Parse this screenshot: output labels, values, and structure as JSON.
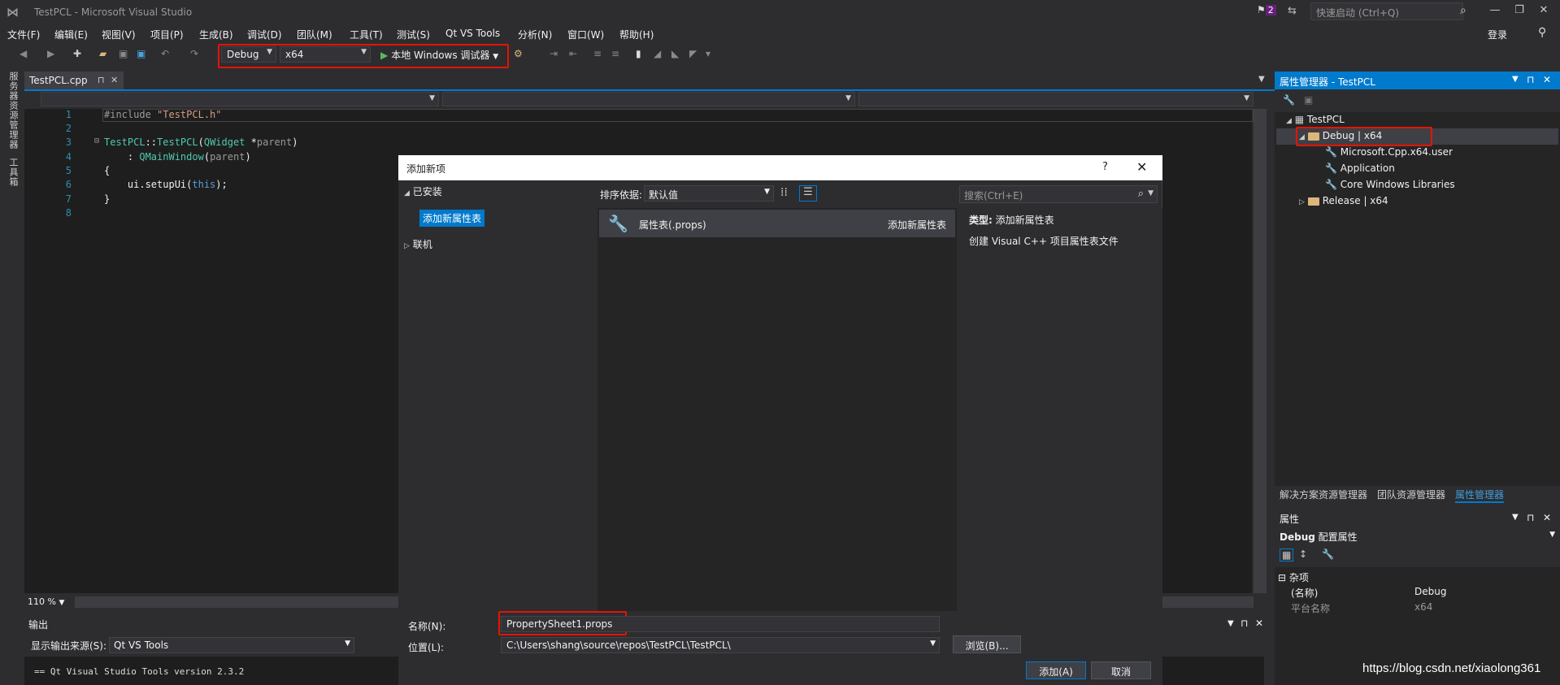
{
  "window": {
    "title": "TestPCL - Microsoft Visual Studio",
    "notification_count": "2",
    "quick_launch_placeholder": "快速启动 (Ctrl+Q)",
    "login": "登录"
  },
  "menu": [
    "文件(F)",
    "编辑(E)",
    "视图(V)",
    "项目(P)",
    "生成(B)",
    "调试(D)",
    "团队(M)",
    "工具(T)",
    "测试(S)",
    "Qt VS Tools",
    "分析(N)",
    "窗口(W)",
    "帮助(H)"
  ],
  "toolbar": {
    "config": "Debug",
    "platform": "x64",
    "run_label": "本地 Windows 调试器"
  },
  "left_tabs": [
    "服务器资源管理器",
    "工具箱"
  ],
  "editor": {
    "tab": "TestPCL.cpp",
    "zoom": "110 %",
    "lines": [
      "1",
      "2",
      "3",
      "4",
      "5",
      "6",
      "7",
      "8"
    ]
  },
  "output": {
    "title": "输出",
    "source_label": "显示输出来源(S):",
    "source": "Qt VS Tools",
    "line": "== Qt Visual Studio Tools version 2.3.2"
  },
  "property_manager": {
    "title": "属性管理器 - TestPCL",
    "project": "TestPCL",
    "debug": "Debug | x64",
    "children": [
      "Microsoft.Cpp.x64.user",
      "Application",
      "Core Windows Libraries"
    ],
    "release": "Release | x64",
    "tabs": [
      "解决方案资源管理器",
      "团队资源管理器",
      "属性管理器"
    ]
  },
  "properties": {
    "title": "属性",
    "object_name": "Debug",
    "object_type": "配置属性",
    "category": "杂项",
    "rows": [
      {
        "name": "(名称)",
        "value": "Debug"
      },
      {
        "name": "平台名称",
        "value": "x64"
      }
    ]
  },
  "dialog": {
    "title": "添加新项",
    "help": "?",
    "installed": "已安装",
    "installed_child": "添加新属性表",
    "online": "联机",
    "sort_label": "排序依据:",
    "sort_value": "默认值",
    "search_placeholder": "搜索(Ctrl+E)",
    "template_name": "属性表(.props)",
    "template_category": "添加新属性表",
    "type_label": "类型:",
    "type_value": "添加新属性表",
    "description": "创建 Visual C++ 项目属性表文件",
    "name_label": "名称(N):",
    "name_value": "PropertySheet1.props",
    "location_label": "位置(L):",
    "location_value": "C:\\Users\\shang\\source\\repos\\TestPCL\\TestPCL\\",
    "browse": "浏览(B)...",
    "add": "添加(A)",
    "cancel": "取消"
  },
  "watermark": "https://blog.csdn.net/xiaolong361",
  "colors": {
    "accent": "#007acc",
    "highlight_box": "#e51400",
    "background": "#2d2d30"
  }
}
